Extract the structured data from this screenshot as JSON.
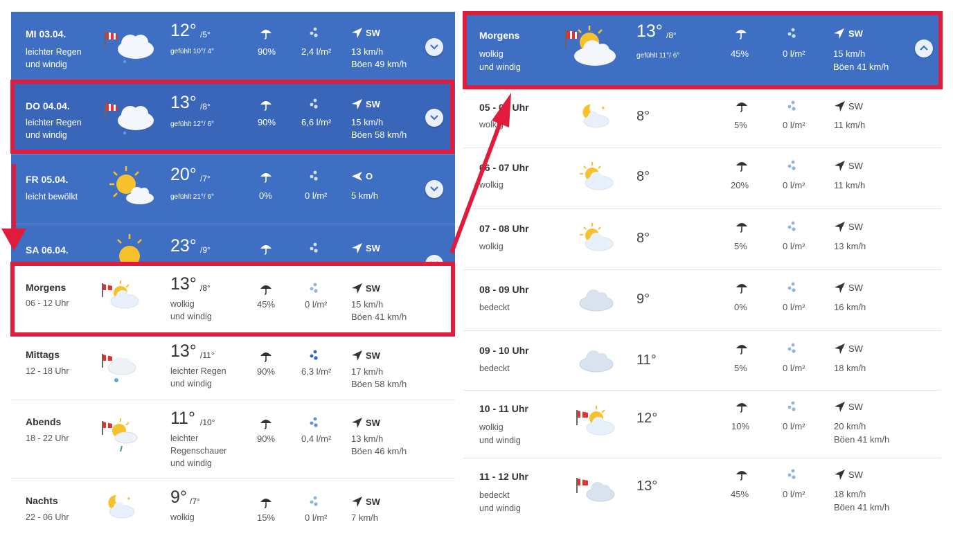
{
  "days": [
    {
      "day": "MI 03.04.",
      "desc1": "leichter Regen",
      "desc2": "und windig",
      "temp": "12°",
      "min": "/5°",
      "feel": "gefühlt 10°/ 4°",
      "prob": "90%",
      "rain": "2,4 l/m²",
      "dir": "SW",
      "wind": "13 km/h",
      "gusts": "Böen 49 km/h",
      "icon": "windsock-cloud-rain-icon"
    },
    {
      "day": "DO 04.04.",
      "desc1": "leichter Regen",
      "desc2": "und windig",
      "temp": "13°",
      "min": "/8°",
      "feel": "gefühlt 12°/ 6°",
      "prob": "90%",
      "rain": "6,6 l/m²",
      "dir": "SW",
      "wind": "15 km/h",
      "gusts": "Böen 58 km/h",
      "icon": "windsock-cloud-rain-icon"
    },
    {
      "day": "FR 05.04.",
      "desc1": "leicht bewölkt",
      "desc2": "",
      "temp": "20°",
      "min": "/7°",
      "feel": "gefühlt 21°/ 6°",
      "prob": "0%",
      "rain": "0 l/m²",
      "dir": "O",
      "wind": "5 km/h",
      "gusts": "",
      "icon": "sun-cloud-icon"
    },
    {
      "day": "SA 06.04.",
      "desc1": "",
      "desc2": "",
      "temp": "23°",
      "min": "/9°",
      "feel": "",
      "prob": "",
      "rain": "",
      "dir": "SW",
      "wind": "",
      "gusts": "",
      "icon": "sun-icon"
    }
  ],
  "parts": [
    {
      "name": "Morgens",
      "range": "06 - 12 Uhr",
      "temp": "13°",
      "min": "/8°",
      "desc1": "wolkig",
      "desc2": "und windig",
      "desc3": "",
      "prob": "45%",
      "rain": "0 l/m²",
      "dir": "SW",
      "wind": "15 km/h",
      "gusts": "Böen 41 km/h",
      "icon": "windsock-sun-cloud-icon"
    },
    {
      "name": "Mittags",
      "range": "12 - 18 Uhr",
      "temp": "13°",
      "min": "/11°",
      "desc1": "leichter Regen",
      "desc2": "und windig",
      "desc3": "",
      "prob": "90%",
      "rain": "6,3 l/m²",
      "dir": "SW",
      "wind": "17 km/h",
      "gusts": "Böen 58 km/h",
      "icon": "windsock-cloud-rain-icon"
    },
    {
      "name": "Abends",
      "range": "18 - 22 Uhr",
      "temp": "11°",
      "min": "/10°",
      "desc1": "leichter",
      "desc2": "Regenschauer",
      "desc3": "und windig",
      "prob": "90%",
      "rain": "0,4 l/m²",
      "dir": "SW",
      "wind": "13 km/h",
      "gusts": "Böen 46 km/h",
      "icon": "windsock-sun-cloud-rain-icon"
    },
    {
      "name": "Nachts",
      "range": "22 - 06 Uhr",
      "temp": "9°",
      "min": "/7°",
      "desc1": "wolkig",
      "desc2": "",
      "desc3": "",
      "prob": "15%",
      "rain": "0 l/m²",
      "dir": "SW",
      "wind": "7 km/h",
      "gusts": "",
      "icon": "moon-cloud-icon"
    }
  ],
  "detail_header": {
    "name": "Morgens",
    "desc1": "wolkig",
    "desc2": "und windig",
    "temp": "13°",
    "min": "/8°",
    "feel": "gefühlt 11°/ 6°",
    "prob": "45%",
    "rain": "0 l/m²",
    "dir": "SW",
    "wind": "15 km/h",
    "gusts": "Böen 41 km/h"
  },
  "hours": [
    {
      "range": "05 - 06 Uhr",
      "desc1": "wolkig",
      "desc2": "",
      "temp": "8°",
      "prob": "5%",
      "rain": "0 l/m²",
      "dir": "SW",
      "wind": "11 km/h",
      "gusts": "",
      "icon": "moon-cloud-icon"
    },
    {
      "range": "06 - 07 Uhr",
      "desc1": "wolkig",
      "desc2": "",
      "temp": "8°",
      "prob": "20%",
      "rain": "0 l/m²",
      "dir": "SW",
      "wind": "11 km/h",
      "gusts": "",
      "icon": "sun-cloud-icon"
    },
    {
      "range": "07 - 08 Uhr",
      "desc1": "wolkig",
      "desc2": "",
      "temp": "8°",
      "prob": "5%",
      "rain": "0 l/m²",
      "dir": "SW",
      "wind": "13 km/h",
      "gusts": "",
      "icon": "sun-cloud-icon"
    },
    {
      "range": "08 - 09 Uhr",
      "desc1": "bedeckt",
      "desc2": "",
      "temp": "9°",
      "prob": "0%",
      "rain": "0 l/m²",
      "dir": "SW",
      "wind": "16 km/h",
      "gusts": "",
      "icon": "cloud-icon"
    },
    {
      "range": "09 - 10 Uhr",
      "desc1": "bedeckt",
      "desc2": "",
      "temp": "11°",
      "prob": "5%",
      "rain": "0 l/m²",
      "dir": "SW",
      "wind": "18 km/h",
      "gusts": "",
      "icon": "cloud-icon"
    },
    {
      "range": "10 - 11 Uhr",
      "desc1": "wolkig",
      "desc2": "und windig",
      "temp": "12°",
      "prob": "10%",
      "rain": "0 l/m²",
      "dir": "SW",
      "wind": "20 km/h",
      "gusts": "Böen 41 km/h",
      "icon": "windsock-sun-cloud-icon"
    },
    {
      "range": "11 - 12 Uhr",
      "desc1": "bedeckt",
      "desc2": "und windig",
      "temp": "13°",
      "prob": "45%",
      "rain": "0 l/m²",
      "dir": "SW",
      "wind": "18 km/h",
      "gusts": "Böen 41 km/h",
      "icon": "windsock-cloud-icon"
    }
  ],
  "colors": {
    "header_blue": "#3f6fc3",
    "highlight_red": "#e11b3c",
    "sun": "#f7c12c",
    "cloud": "#f2f6fb"
  }
}
